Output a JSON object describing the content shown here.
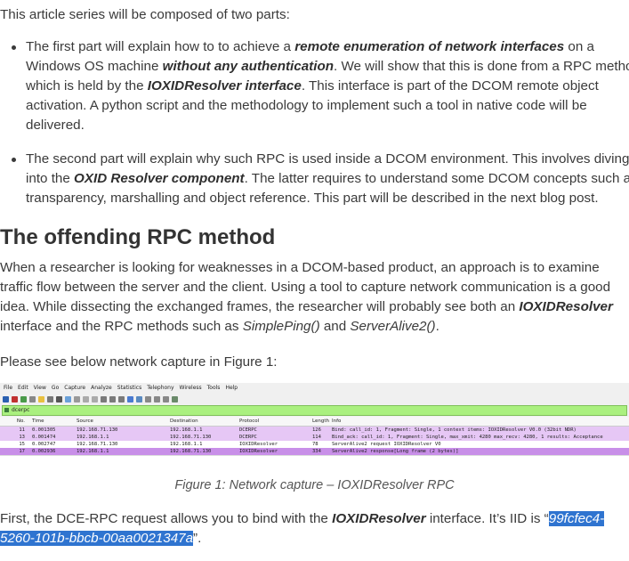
{
  "intro": "This article series will be composed of two parts:",
  "bullet1": {
    "t1": "The first part will explain how to to achieve a ",
    "b1": "remote enumeration of network interfaces",
    "t2": " on a Windows OS machine ",
    "b2": "without any authentication",
    "t3": ". We will show that this is done from a RPC method which is held by the ",
    "b3": "IOXIDResolver interface",
    "t4": ". This interface is part of the DCOM remote object activation. A python script and the methodology to implement such a tool in native code will be delivered."
  },
  "bullet2": {
    "t1": "The second part will explain why such RPC is used inside a DCOM environment. This involves diving into the ",
    "b1": "OXID Resolver component",
    "t2": ". The latter requires to understand some DCOM concepts such as transparency, marshalling and object reference. This part will be described in the next blog post."
  },
  "heading": "The offending RPC method",
  "para2": {
    "t1": "When a researcher is looking for weaknesses in a DCOM-based product, an approach is to examine traffic flow between the server and the client. Using a tool to capture  network communication is a good idea. While dissecting the exchanged frames, the researcher will probably see both an ",
    "b1": "IOXIDResolver",
    "t2": " interface and the RPC methods such as ",
    "i1": "SimplePing()",
    "t3": " and ",
    "i2": "ServerAlive2()",
    "t4": "."
  },
  "para3": "Please see below network capture in Figure 1:",
  "capture": {
    "menu": [
      "File",
      "Edit",
      "View",
      "Go",
      "Capture",
      "Analyze",
      "Statistics",
      "Telephony",
      "Wireless",
      "Tools",
      "Help"
    ],
    "filter": "dcerpc",
    "filter_color": "#aaf07f",
    "columns": [
      "No.",
      "Time",
      "Source",
      "Destination",
      "Protocol",
      "Length",
      "Info"
    ],
    "rows": [
      {
        "no": "11",
        "time": "0.001305",
        "source": "192.168.71.130",
        "destination": "192.168.1.1",
        "protocol": "DCERPC",
        "length": "126",
        "info": "Bind: call_id: 1, Fragment: Single, 1 context items: IOXIDResolver V0.0 (32bit NDR)",
        "color": "#e6c7f5"
      },
      {
        "no": "13",
        "time": "0.001474",
        "source": "192.168.1.1",
        "destination": "192.168.71.130",
        "protocol": "DCERPC",
        "length": "114",
        "info": "Bind_ack: call_id: 1, Fragment: Single, max_xmit: 4280 max_recv: 4280, 1 results: Acceptance",
        "color": "#e6c7f5"
      },
      {
        "no": "15",
        "time": "0.002747",
        "source": "192.168.71.130",
        "destination": "192.168.1.1",
        "protocol": "IOXIDResolver",
        "length": "78",
        "info": "ServerAlive2 request IOXIDResolver V0",
        "color": "#ffffff"
      },
      {
        "no": "17",
        "time": "0.002936",
        "source": "192.168.1.1",
        "destination": "192.168.71.130",
        "protocol": "IOXIDResolver",
        "length": "334",
        "info": "ServerAlive2 response[Long frame (2 bytes)]",
        "color": "#c88fe8"
      }
    ]
  },
  "caption": "Figure 1: Network capture – IOXIDResolver RPC",
  "para4": {
    "t1": "First, the DCE-RPC request allows you to bind with the ",
    "b1": "IOXIDResolver",
    "t2": " interface. It’s IID is “",
    "iid": "99fcfec4-5260-101b-bbcb-00aa0021347a",
    "t3": "”."
  },
  "colors": {
    "text": "#3a3a3a",
    "selection": "#2f74d0",
    "dcerpc_row": "#e6c7f5",
    "selected_row": "#c88fe8"
  }
}
